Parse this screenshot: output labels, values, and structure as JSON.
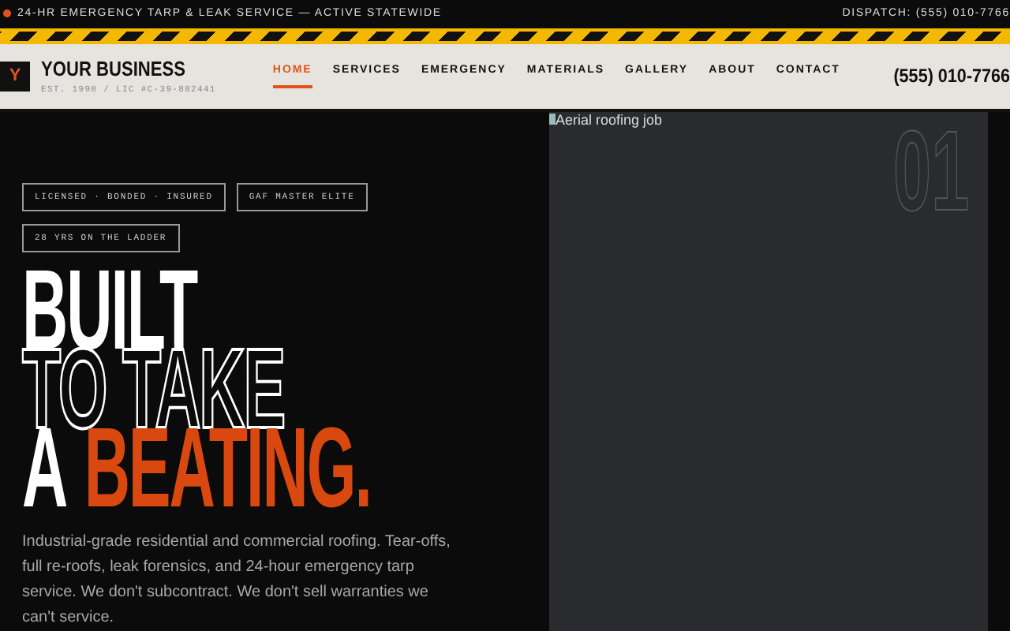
{
  "top_bar": {
    "announcement": "24-HR EMERGENCY TARP & LEAK SERVICE — ACTIVE STATEWIDE",
    "dispatch": "DISPATCH: (555) 010-7766"
  },
  "header": {
    "logo_letter": "Y",
    "business_name": "YOUR BUSINESS",
    "license": "EST. 1998 / LIC #C-39-882441",
    "phone": "(555) 010-7766"
  },
  "nav": [
    {
      "label": "HOME",
      "selected": true
    },
    {
      "label": "SERVICES",
      "selected": false
    },
    {
      "label": "EMERGENCY",
      "selected": false
    },
    {
      "label": "MATERIALS",
      "selected": false
    },
    {
      "label": "GALLERY",
      "selected": false
    },
    {
      "label": "ABOUT",
      "selected": false
    },
    {
      "label": "CONTACT",
      "selected": false
    }
  ],
  "badges": [
    "LICENSED · BONDED · INSURED",
    "GAF MASTER ELITE",
    "28 YRS ON THE LADDER"
  ],
  "headline": [
    {
      "text": "BUILT",
      "kind": "solid"
    },
    {
      "text": "TO TAKE",
      "kind": "outline"
    },
    {
      "text": "A",
      "kind": "solid"
    },
    {
      "text": "BEATING.",
      "kind": "accent"
    }
  ],
  "intro": "Industrial-grade residential and commercial roofing. Tear-offs, full re-roofs, leak forensics, and 24-hour emergency tarp service. We don't subcontract. We don't sell warranties we can't service.",
  "media": {
    "alt_text": "Aerial roofing job",
    "number": "01"
  }
}
